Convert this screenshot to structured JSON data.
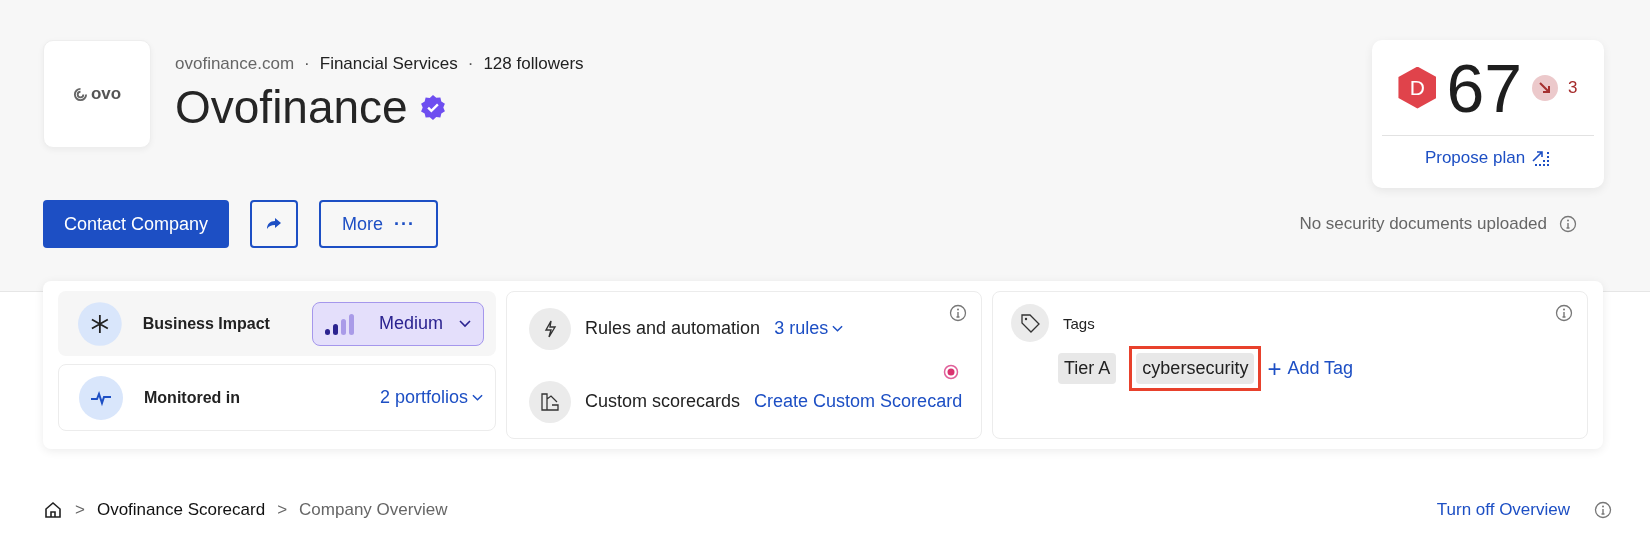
{
  "company": {
    "logo_text": "ovo",
    "domain": "ovofinance.com",
    "separator": "·",
    "industry": "Financial Services",
    "followers": "128 followers",
    "name": "Ovofinance",
    "verified": true
  },
  "actions": {
    "contact": "Contact Company",
    "more": "More",
    "more_icon": "···"
  },
  "security_docs": "No security documents uploaded",
  "score": {
    "grade": "D",
    "value": "67",
    "change": "3",
    "trend_down": true,
    "propose": "Propose plan"
  },
  "business_impact": {
    "label": "Business Impact",
    "value": "Medium",
    "level": 0.5
  },
  "monitored": {
    "label": "Monitored in",
    "value": "2 portfolios"
  },
  "rules": {
    "label": "Rules and automation",
    "value": "3 rules"
  },
  "scorecards": {
    "label": "Custom scorecards",
    "link": "Create Custom Scorecard",
    "new_dot": true
  },
  "tags": {
    "label": "Tags",
    "items": [
      {
        "label": "Tier A",
        "highlighted": false
      },
      {
        "label": "cybersecurity",
        "highlighted": true
      }
    ],
    "add": "Add Tag",
    "add_icon": "+"
  },
  "breadcrumb": {
    "items": [
      {
        "label": "Ovofinance Scorecard",
        "current": false
      },
      {
        "label": "Company Overview",
        "current": true
      }
    ],
    "separator": ">"
  },
  "turn_off": "Turn off Overview"
}
